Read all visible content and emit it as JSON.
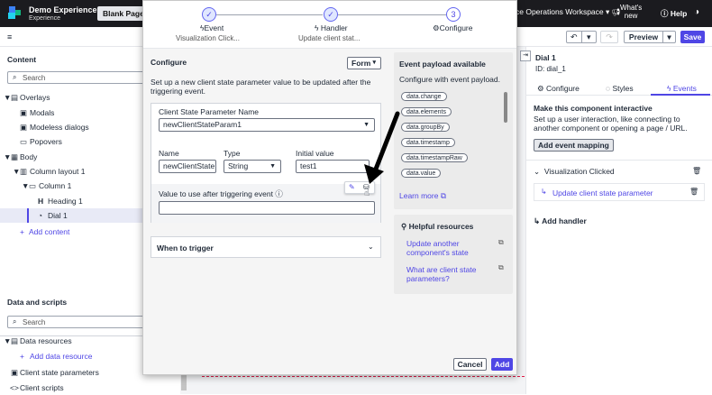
{
  "app": {
    "title": "Demo Experience",
    "subtitle": "Experience",
    "page_button": "Blank Page",
    "workspace": "ce Operations Workspace",
    "whats_new_1": "What's",
    "whats_new_2": "new",
    "help": "Help"
  },
  "toolbar": {
    "preview": "Preview",
    "save": "Save",
    "hamburger": "≡"
  },
  "left": {
    "content_title": "Content",
    "search_placeholder": "Search",
    "tree": [
      {
        "label": "Overlays",
        "prefix": "▼"
      },
      {
        "label": "Modals"
      },
      {
        "label": "Modeless dialogs"
      },
      {
        "label": "Popovers"
      },
      {
        "label": "Body",
        "prefix": "▼"
      },
      {
        "label": "Column layout 1",
        "prefix": "▼"
      },
      {
        "label": "Column 1",
        "prefix": "▼"
      },
      {
        "label": "Heading 1"
      },
      {
        "label": "Dial 1"
      },
      {
        "label": "Add content"
      }
    ],
    "data_title": "Data and scripts",
    "data_search_placeholder": "Search",
    "data_items": [
      {
        "label": "Data resources",
        "prefix": "▼"
      },
      {
        "label": "Add data resource"
      },
      {
        "label": "Client state parameters"
      },
      {
        "label": "Client scripts"
      }
    ]
  },
  "right": {
    "title": "Dial 1",
    "id_label": "ID: dial_1",
    "tabs": [
      "Configure",
      "Styles",
      "Events"
    ],
    "interactive_title": "Make this component interactive",
    "interactive_desc": "Set up a user interaction, like connecting to another component or opening a page / URL.",
    "add_event_mapping": "Add event mapping",
    "event_name": "Visualization Clicked",
    "handler_name": "Update client state parameter",
    "add_handler": "Add handler"
  },
  "modal": {
    "steps": [
      {
        "num": "✓",
        "label": "Event",
        "sub": "Visualization Click..."
      },
      {
        "num": "✓",
        "label": "Handler",
        "sub": "Update client stat..."
      },
      {
        "num": "3",
        "label": "Configure",
        "sub": ""
      }
    ],
    "configure_title": "Configure",
    "form_dropdown": "Form",
    "description": "Set up a new client state parameter value to be updated after the triggering event.",
    "param_name_label": "Client State Parameter Name",
    "param_name_value": "newClientStateParam1",
    "name_label": "Name",
    "name_value": "newClientState",
    "type_label": "Type",
    "type_value": "String",
    "initial_label": "Initial value",
    "initial_value": "test1",
    "value_after_label": "Value to use after triggering event",
    "when_to_trigger": "When to trigger",
    "payload_title": "Event payload available",
    "payload_desc": "Configure with event payload.",
    "payload_tags": [
      "data.change",
      "data.elements",
      "data.groupBy",
      "data.timestamp",
      "data.timestampRaw",
      "data.value"
    ],
    "learn_more": "Learn more",
    "helpful_title": "Helpful resources",
    "helpful_links": [
      {
        "line1": "Update another",
        "line2": "component's state"
      },
      {
        "line1": "What are client state",
        "line2": "parameters?"
      }
    ],
    "cancel": "Cancel",
    "add": "Add"
  },
  "colors": {
    "accent": "#4f46e5",
    "topbar": "#1b1b1f"
  }
}
